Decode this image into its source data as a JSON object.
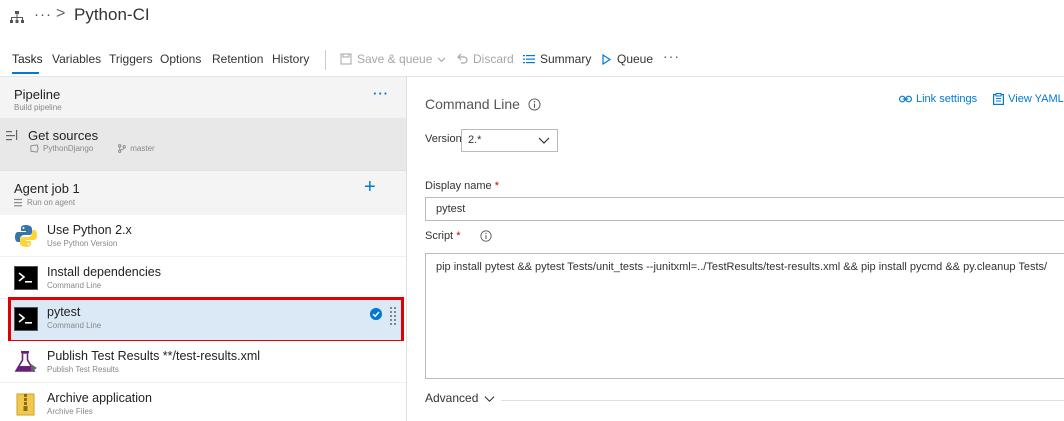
{
  "header": {
    "ellipsis": "···",
    "chevron": ">",
    "title": "Python-CI"
  },
  "tabs": [
    "Tasks",
    "Variables",
    "Triggers",
    "Options",
    "Retention",
    "History"
  ],
  "toolbar": {
    "save_queue": "Save & queue",
    "discard": "Discard",
    "summary": "Summary",
    "queue": "Queue",
    "more": "···"
  },
  "pipeline": {
    "title": "Pipeline",
    "subtitle": "Build pipeline",
    "more": "···"
  },
  "get_sources": {
    "title": "Get sources",
    "repo": "PythonDjango",
    "branch": "master"
  },
  "agent_job": {
    "title": "Agent job 1",
    "subtitle": "Run on agent",
    "add": "+"
  },
  "tasks": [
    {
      "name": "Use Python 2.x",
      "sub": "Use Python Version",
      "icon": "python-icon"
    },
    {
      "name": "Install dependencies",
      "sub": "Command Line",
      "icon": "command-line-icon"
    },
    {
      "name": "pytest",
      "sub": "Command Line",
      "icon": "command-line-icon"
    },
    {
      "name": "Publish Test Results **/test-results.xml",
      "sub": "Publish Test Results",
      "icon": "flask-icon"
    },
    {
      "name": "Archive application",
      "sub": "Archive Files",
      "icon": "archive-icon"
    }
  ],
  "detail": {
    "title": "Command Line",
    "link_settings": "Link settings",
    "view_yaml": "View YAML",
    "version_label": "Version",
    "version_value": "2.*",
    "display_name_label": "Display name",
    "display_name_value": "pytest",
    "script_label": "Script",
    "required_mark": "*",
    "script_value": "pip install pytest && pytest Tests/unit_tests --junitxml=../TestResults/test-results.xml && pip install pycmd && py.cleanup Tests/",
    "advanced": "Advanced"
  },
  "colors": {
    "accent": "#0078d4",
    "selection_bg": "#dbe9f7",
    "highlight_border": "#e00000"
  }
}
